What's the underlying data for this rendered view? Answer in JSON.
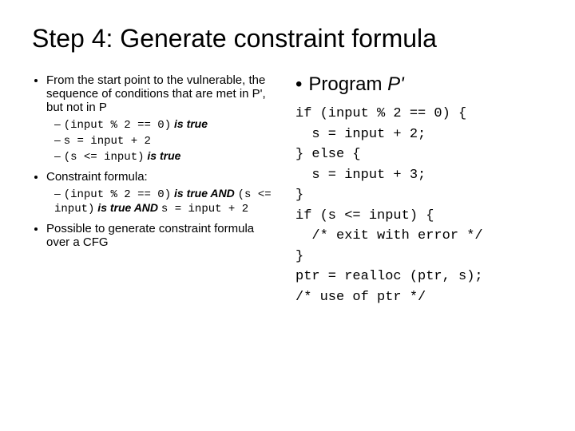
{
  "title": "Step 4: Generate constraint formula",
  "left": {
    "b1": "From the start point to the vulnerable, the sequence of conditions that are met in P', but not in P",
    "b1s1a": "(input % 2 == 0)",
    "b1s1b": " is true",
    "b1s2": "s = input + 2",
    "b1s3a": "(s <= input)",
    "b1s3b": " is true",
    "b2": "Constraint formula:",
    "b2s1a": "(input % 2 == 0)",
    "b2s1b": " is true AND ",
    "b2s1c": "(s <= input)",
    "b2s1d": " is true AND ",
    "b2s1e": "s = input + 2",
    "b3": "Possible to generate constraint formula over a CFG"
  },
  "right": {
    "heading_prefix": "Program ",
    "heading_prog": "P'",
    "code": "if (input % 2 == 0) {\n  s = input + 2;\n} else {\n  s = input + 3;\n}\nif (s <= input) {\n  /* exit with error */\n}\nptr = realloc (ptr, s);\n/* use of ptr */"
  }
}
